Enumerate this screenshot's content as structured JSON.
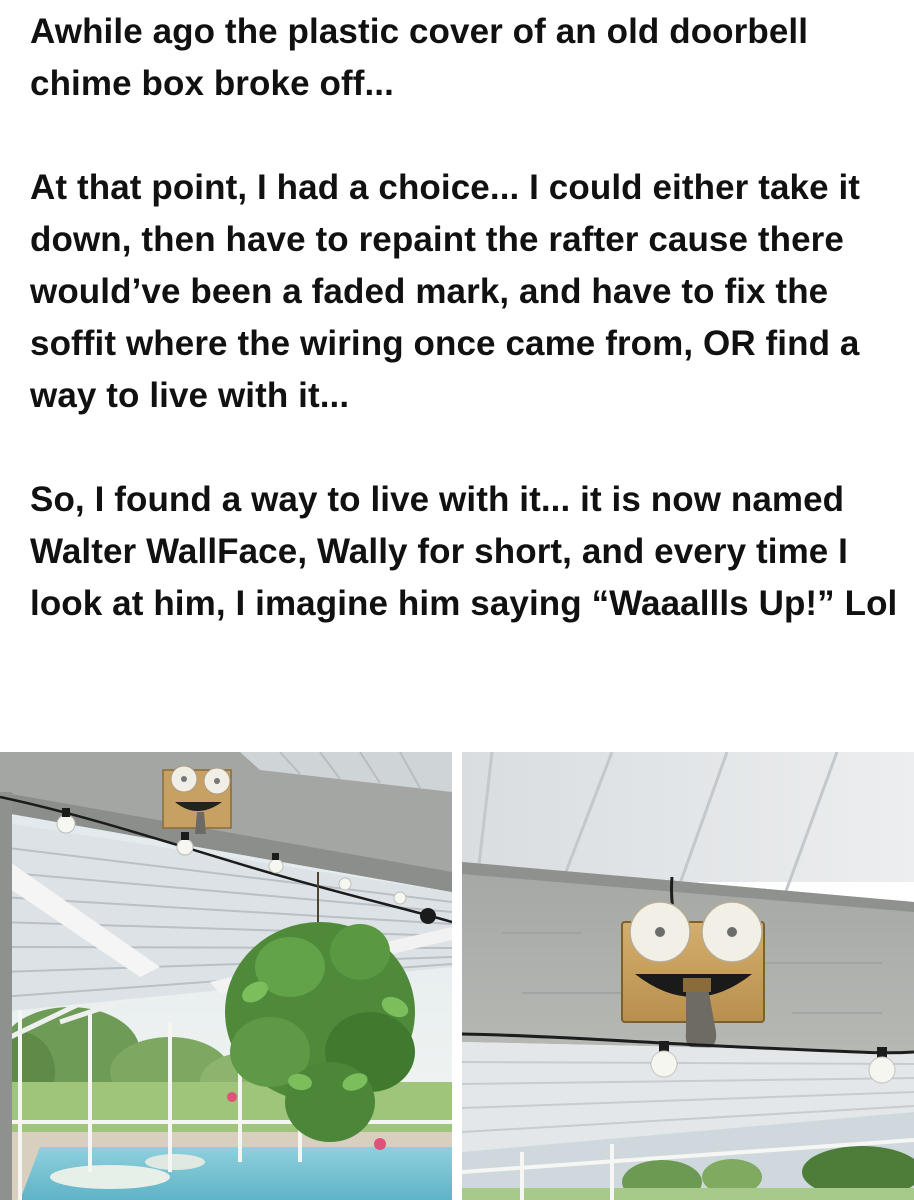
{
  "post": {
    "paragraphs": [
      "Awhile ago the plastic cover of an old doorbell chime box broke off...",
      "At that point, I had a choice... I could either take it down, then have to repaint the rafter cause there would’ve been a faded mark, and have to fix the soffit where the wiring once came from, OR find a way to live with it...",
      "So, I found a way to live with it... it is now named Walter WallFace, Wally for short, and every time I look at him, I imagine him saying “Waaallls Up!” Lol"
    ]
  },
  "photos": [
    {
      "subject": "patio-wide-shot"
    },
    {
      "subject": "wally-closeup"
    }
  ],
  "colors": {
    "text": "#111111",
    "background": "#ffffff",
    "soffit": "#dfe3e6",
    "beam": "#9a9c9a",
    "chime_box": "#c9a463",
    "face_disc": "#f1eee6",
    "pool": "#7fc7d8",
    "foliage": "#4f8a3a"
  }
}
